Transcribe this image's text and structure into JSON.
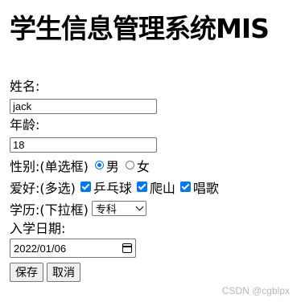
{
  "page_title": "学生信息管理系统MIS",
  "form": {
    "name_label": "姓名:",
    "name_value": "jack",
    "age_label": "年龄:",
    "age_value": "18",
    "gender_label": "性别:(单选框)",
    "gender_options": [
      {
        "label": "男",
        "checked": true
      },
      {
        "label": "女",
        "checked": false
      }
    ],
    "hobby_label": "爱好:(多选)",
    "hobby_options": [
      {
        "label": "乒乓球",
        "checked": true
      },
      {
        "label": "爬山",
        "checked": true
      },
      {
        "label": "唱歌",
        "checked": true
      }
    ],
    "education_label": "学历:(下拉框)",
    "education_selected": "专科",
    "date_label": "入学日期:",
    "date_value": "2022/01/06",
    "save_label": "保存",
    "cancel_label": "取消"
  },
  "watermark": "CSDN @cgblpx",
  "colors": {
    "accent": "#0075ff"
  }
}
